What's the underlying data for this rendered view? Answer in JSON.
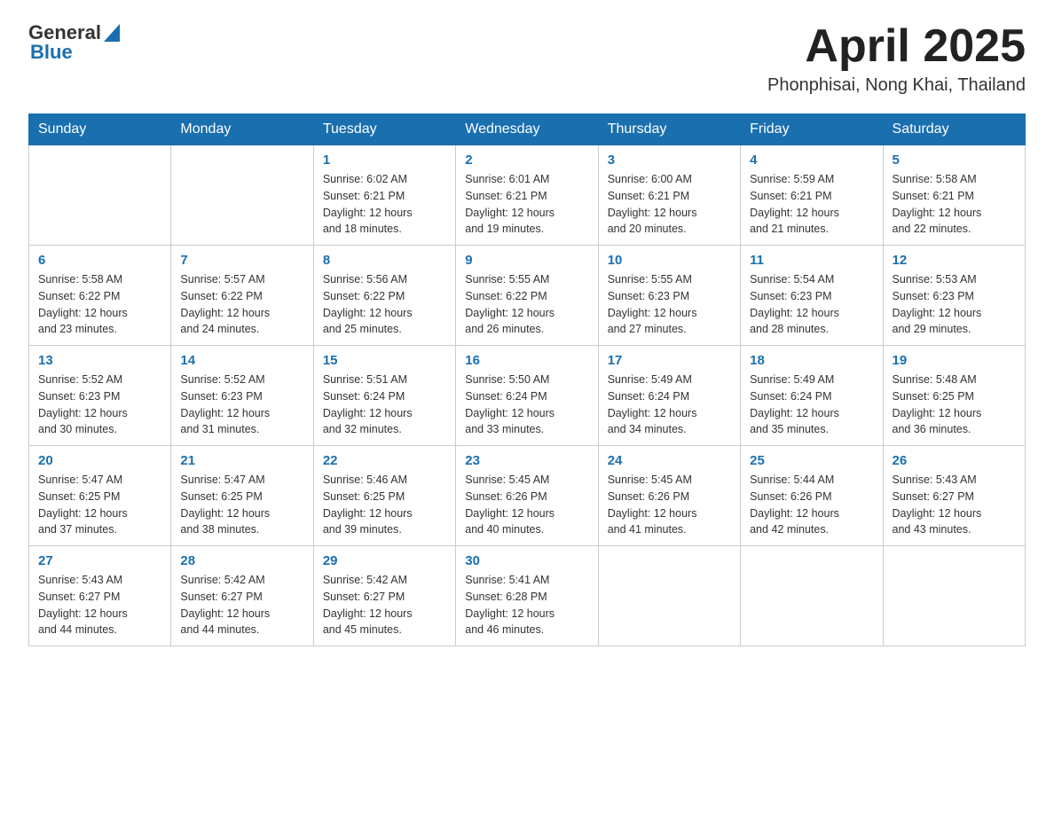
{
  "header": {
    "logo": {
      "general": "General",
      "blue": "Blue"
    },
    "title": "April 2025",
    "location": "Phonphisai, Nong Khai, Thailand"
  },
  "days_of_week": [
    "Sunday",
    "Monday",
    "Tuesday",
    "Wednesday",
    "Thursday",
    "Friday",
    "Saturday"
  ],
  "weeks": [
    [
      {
        "day": "",
        "info": ""
      },
      {
        "day": "",
        "info": ""
      },
      {
        "day": "1",
        "info": "Sunrise: 6:02 AM\nSunset: 6:21 PM\nDaylight: 12 hours\nand 18 minutes."
      },
      {
        "day": "2",
        "info": "Sunrise: 6:01 AM\nSunset: 6:21 PM\nDaylight: 12 hours\nand 19 minutes."
      },
      {
        "day": "3",
        "info": "Sunrise: 6:00 AM\nSunset: 6:21 PM\nDaylight: 12 hours\nand 20 minutes."
      },
      {
        "day": "4",
        "info": "Sunrise: 5:59 AM\nSunset: 6:21 PM\nDaylight: 12 hours\nand 21 minutes."
      },
      {
        "day": "5",
        "info": "Sunrise: 5:58 AM\nSunset: 6:21 PM\nDaylight: 12 hours\nand 22 minutes."
      }
    ],
    [
      {
        "day": "6",
        "info": "Sunrise: 5:58 AM\nSunset: 6:22 PM\nDaylight: 12 hours\nand 23 minutes."
      },
      {
        "day": "7",
        "info": "Sunrise: 5:57 AM\nSunset: 6:22 PM\nDaylight: 12 hours\nand 24 minutes."
      },
      {
        "day": "8",
        "info": "Sunrise: 5:56 AM\nSunset: 6:22 PM\nDaylight: 12 hours\nand 25 minutes."
      },
      {
        "day": "9",
        "info": "Sunrise: 5:55 AM\nSunset: 6:22 PM\nDaylight: 12 hours\nand 26 minutes."
      },
      {
        "day": "10",
        "info": "Sunrise: 5:55 AM\nSunset: 6:23 PM\nDaylight: 12 hours\nand 27 minutes."
      },
      {
        "day": "11",
        "info": "Sunrise: 5:54 AM\nSunset: 6:23 PM\nDaylight: 12 hours\nand 28 minutes."
      },
      {
        "day": "12",
        "info": "Sunrise: 5:53 AM\nSunset: 6:23 PM\nDaylight: 12 hours\nand 29 minutes."
      }
    ],
    [
      {
        "day": "13",
        "info": "Sunrise: 5:52 AM\nSunset: 6:23 PM\nDaylight: 12 hours\nand 30 minutes."
      },
      {
        "day": "14",
        "info": "Sunrise: 5:52 AM\nSunset: 6:23 PM\nDaylight: 12 hours\nand 31 minutes."
      },
      {
        "day": "15",
        "info": "Sunrise: 5:51 AM\nSunset: 6:24 PM\nDaylight: 12 hours\nand 32 minutes."
      },
      {
        "day": "16",
        "info": "Sunrise: 5:50 AM\nSunset: 6:24 PM\nDaylight: 12 hours\nand 33 minutes."
      },
      {
        "day": "17",
        "info": "Sunrise: 5:49 AM\nSunset: 6:24 PM\nDaylight: 12 hours\nand 34 minutes."
      },
      {
        "day": "18",
        "info": "Sunrise: 5:49 AM\nSunset: 6:24 PM\nDaylight: 12 hours\nand 35 minutes."
      },
      {
        "day": "19",
        "info": "Sunrise: 5:48 AM\nSunset: 6:25 PM\nDaylight: 12 hours\nand 36 minutes."
      }
    ],
    [
      {
        "day": "20",
        "info": "Sunrise: 5:47 AM\nSunset: 6:25 PM\nDaylight: 12 hours\nand 37 minutes."
      },
      {
        "day": "21",
        "info": "Sunrise: 5:47 AM\nSunset: 6:25 PM\nDaylight: 12 hours\nand 38 minutes."
      },
      {
        "day": "22",
        "info": "Sunrise: 5:46 AM\nSunset: 6:25 PM\nDaylight: 12 hours\nand 39 minutes."
      },
      {
        "day": "23",
        "info": "Sunrise: 5:45 AM\nSunset: 6:26 PM\nDaylight: 12 hours\nand 40 minutes."
      },
      {
        "day": "24",
        "info": "Sunrise: 5:45 AM\nSunset: 6:26 PM\nDaylight: 12 hours\nand 41 minutes."
      },
      {
        "day": "25",
        "info": "Sunrise: 5:44 AM\nSunset: 6:26 PM\nDaylight: 12 hours\nand 42 minutes."
      },
      {
        "day": "26",
        "info": "Sunrise: 5:43 AM\nSunset: 6:27 PM\nDaylight: 12 hours\nand 43 minutes."
      }
    ],
    [
      {
        "day": "27",
        "info": "Sunrise: 5:43 AM\nSunset: 6:27 PM\nDaylight: 12 hours\nand 44 minutes."
      },
      {
        "day": "28",
        "info": "Sunrise: 5:42 AM\nSunset: 6:27 PM\nDaylight: 12 hours\nand 44 minutes."
      },
      {
        "day": "29",
        "info": "Sunrise: 5:42 AM\nSunset: 6:27 PM\nDaylight: 12 hours\nand 45 minutes."
      },
      {
        "day": "30",
        "info": "Sunrise: 5:41 AM\nSunset: 6:28 PM\nDaylight: 12 hours\nand 46 minutes."
      },
      {
        "day": "",
        "info": ""
      },
      {
        "day": "",
        "info": ""
      },
      {
        "day": "",
        "info": ""
      }
    ]
  ]
}
